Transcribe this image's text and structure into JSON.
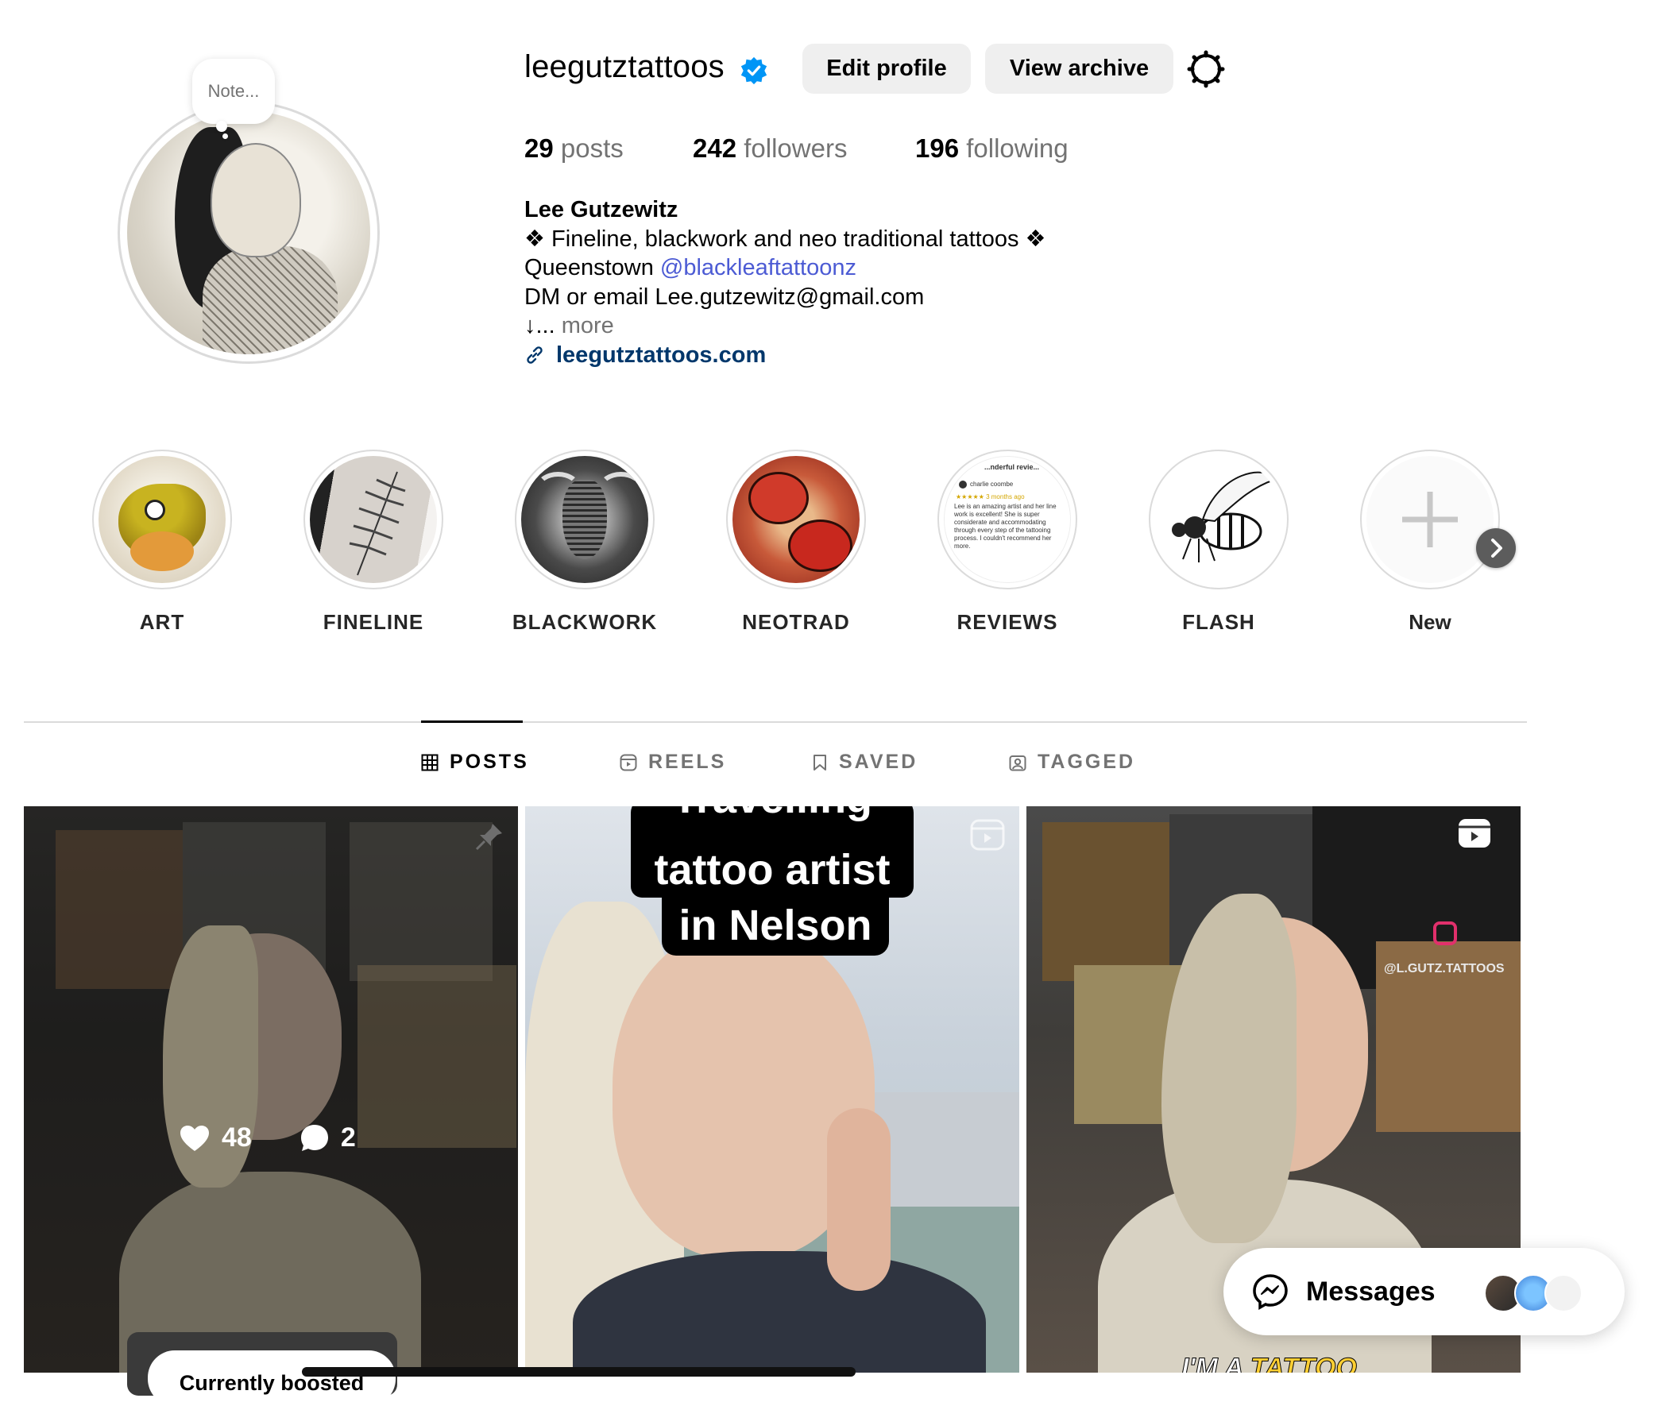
{
  "profile": {
    "note_placeholder": "Note...",
    "username": "leegutztattoos",
    "verified": true,
    "edit_profile_label": "Edit profile",
    "view_archive_label": "View archive",
    "stats": {
      "posts_count": "29",
      "posts_label": "posts",
      "followers_count": "242",
      "followers_label": "followers",
      "following_count": "196",
      "following_label": "following"
    },
    "bio": {
      "name": "Lee Gutzewitz",
      "line1": "❖ Fineline, blackwork and neo traditional tattoos ❖",
      "line2_prefix": "Queenstown ",
      "line2_mention": "@blackleaftattoonz",
      "line3": "DM or email Lee.gutzewitz@gmail.com",
      "line4_prefix": "↓...",
      "more_label": "more",
      "website": "leegutztattoos.com"
    }
  },
  "highlights": [
    {
      "label": "ART"
    },
    {
      "label": "FINELINE"
    },
    {
      "label": "BLACKWORK"
    },
    {
      "label": "NEOTRAD"
    },
    {
      "label": "REVIEWS"
    },
    {
      "label": "FLASH"
    },
    {
      "label": "New"
    }
  ],
  "review_card": {
    "title": "...nderful revie...",
    "reviewer": "charlie coombe",
    "meta": "★★★★★ 3 months ago",
    "text": "Lee is an amazing artist and her line work is excellent! She is super considerate and accommodating through every step of the tattooing process. I couldn't recommend her more."
  },
  "tabs": [
    {
      "label": "POSTS",
      "active": true,
      "icon": "grid-icon"
    },
    {
      "label": "REELS",
      "active": false,
      "icon": "reels-icon"
    },
    {
      "label": "SAVED",
      "active": false,
      "icon": "bookmark-icon"
    },
    {
      "label": "TAGGED",
      "active": false,
      "icon": "tagged-icon"
    }
  ],
  "posts": [
    {
      "likes": "48",
      "comments": "2",
      "pinned": true
    },
    {
      "caption_line0": "Travelling",
      "caption_line1": "tattoo artist",
      "caption_line2": "in Nelson",
      "type": "reel"
    },
    {
      "watermark": "@L.GUTZ.TATTOOS",
      "bottom_text_1": "I'M A",
      "bottom_text_2": "TATTOO",
      "type": "reel"
    }
  ],
  "boosted_label": "Currently boosted",
  "messages_label": "Messages",
  "colors": {
    "link_blue": "#4c5bd4",
    "website": "#00376b",
    "verified": "#0095f6",
    "secondary_text": "#737373",
    "button_bg": "#efefef"
  }
}
